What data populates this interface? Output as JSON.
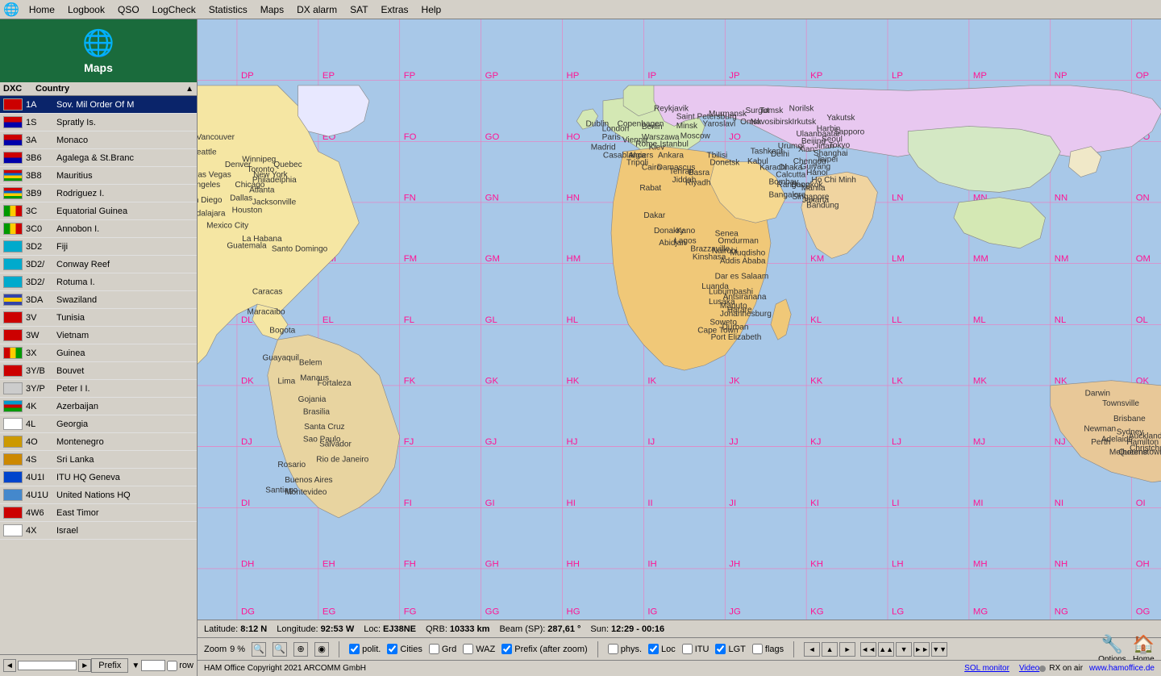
{
  "app": {
    "title": "HAM Office"
  },
  "menubar": {
    "icon": "🌐",
    "items": [
      "Home",
      "Logbook",
      "QSO",
      "LogCheck",
      "Statistics",
      "Maps",
      "DX alarm",
      "SAT",
      "Extras",
      "Help"
    ]
  },
  "sidebar": {
    "title": "Maps",
    "globe_icon": "🌐",
    "col_dxc": "DXC",
    "col_country": "Country",
    "rows": [
      {
        "prefix": "1A",
        "country": "Sov. Mil Order Of M",
        "flag_class": "flag-red",
        "selected": true
      },
      {
        "prefix": "1S",
        "country": "Spratly Is.",
        "flag_class": "flag-striped-rb"
      },
      {
        "prefix": "3A",
        "country": "Monaco",
        "flag_class": "flag-striped-rb"
      },
      {
        "prefix": "3B6",
        "country": "Agalega & St.Branc",
        "flag_class": "flag-striped-rb"
      },
      {
        "prefix": "3B8",
        "country": "Mauritius",
        "flag_class": "flag-mauritius"
      },
      {
        "prefix": "3B9",
        "country": "Rodriguez I.",
        "flag_class": "flag-mauritius"
      },
      {
        "prefix": "3C",
        "country": "Equatorial Guinea",
        "flag_class": "flag-tricolor"
      },
      {
        "prefix": "3C0",
        "country": "Annobon I.",
        "flag_class": "flag-tricolor"
      },
      {
        "prefix": "3D2",
        "country": "Fiji",
        "flag_class": "flag-fiji"
      },
      {
        "prefix": "3D2/",
        "country": "Conway Reef",
        "flag_class": "flag-fiji"
      },
      {
        "prefix": "3D2/",
        "country": "Rotuma I.",
        "flag_class": "flag-fiji"
      },
      {
        "prefix": "3DA",
        "country": "Swaziland",
        "flag_class": "flag-swazi"
      },
      {
        "prefix": "3V",
        "country": "Tunisia",
        "flag_class": "flag-tunisia"
      },
      {
        "prefix": "3W",
        "country": "Vietnam",
        "flag_class": "flag-vietnam"
      },
      {
        "prefix": "3X",
        "country": "Guinea",
        "flag_class": "flag-guinea"
      },
      {
        "prefix": "3Y/B",
        "country": "Bouvet",
        "flag_class": "flag-bouvet"
      },
      {
        "prefix": "3Y/P",
        "country": "Peter I  I.",
        "flag_class": "flag-peter"
      },
      {
        "prefix": "4K",
        "country": "Azerbaijan",
        "flag_class": "flag-azerbaijan"
      },
      {
        "prefix": "4L",
        "country": "Georgia",
        "flag_class": "flag-georgia"
      },
      {
        "prefix": "4O",
        "country": "Montenegro",
        "flag_class": "flag-montenegro"
      },
      {
        "prefix": "4S",
        "country": "Sri Lanka",
        "flag_class": "flag-srilanka"
      },
      {
        "prefix": "4U1I",
        "country": "ITU HQ Geneva",
        "flag_class": "flag-itu"
      },
      {
        "prefix": "4U1U",
        "country": "United Nations HQ",
        "flag_class": "flag-un"
      },
      {
        "prefix": "4W6",
        "country": "East Timor",
        "flag_class": "flag-timor"
      },
      {
        "prefix": "4X",
        "country": "Israel",
        "flag_class": "flag-israel"
      }
    ],
    "bottom": {
      "prefix_btn": "Prefix",
      "row_label": "row",
      "row_value": ""
    }
  },
  "status": {
    "latitude_label": "Latitude:",
    "latitude_value": "8:12 N",
    "longitude_label": "Longitude:",
    "longitude_value": "92:53 W",
    "loc_label": "Loc:",
    "loc_value": "EJ38NE",
    "qrb_label": "QRB:",
    "qrb_value": "10333 km",
    "beam_label": "Beam (SP):",
    "beam_value": "287,61 °",
    "sun_label": "Sun:",
    "sun_value": "12:29 - 00:16"
  },
  "controls": {
    "zoom_label": "Zoom",
    "zoom_value": "9 %",
    "checkboxes": [
      {
        "id": "chk-polit",
        "label": "polit.",
        "checked": true
      },
      {
        "id": "chk-cities",
        "label": "Cities",
        "checked": true
      },
      {
        "id": "chk-grd",
        "label": "Grd",
        "checked": false
      },
      {
        "id": "chk-waz",
        "label": "WAZ",
        "checked": false
      },
      {
        "id": "chk-prefix-zoom",
        "label": "Prefix (after zoom)",
        "checked": true
      },
      {
        "id": "chk-phys",
        "label": "phys.",
        "checked": false
      },
      {
        "id": "chk-loc",
        "label": "Loc",
        "checked": true
      },
      {
        "id": "chk-itu",
        "label": "ITU",
        "checked": false
      },
      {
        "id": "chk-lgt",
        "label": "LGT",
        "checked": true
      },
      {
        "id": "chk-flags",
        "label": "flags",
        "checked": false
      }
    ],
    "right_buttons": [
      {
        "id": "btn-options",
        "label": "Options",
        "icon": "🔧"
      },
      {
        "id": "btn-home",
        "label": "Home",
        "icon": "🏠"
      }
    ]
  },
  "bottom": {
    "copyright": "HAM Office Copyright 2021 ARCOMM GmbH",
    "sol_monitor": "SOL monitor",
    "video": "Video",
    "rx_status": "RX on air",
    "website": "www.hamoffice.de"
  }
}
